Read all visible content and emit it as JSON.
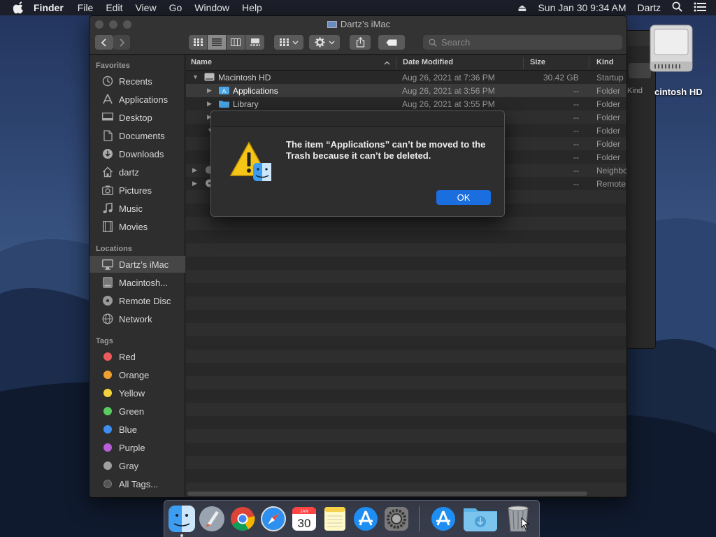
{
  "menubar": {
    "app_name": "Finder",
    "items": [
      "File",
      "Edit",
      "View",
      "Go",
      "Window",
      "Help"
    ],
    "clock": "Sun Jan 30  9:34 AM",
    "user": "Dartz"
  },
  "window": {
    "title": "Dartz’s iMac",
    "search_placeholder": "Search"
  },
  "sidebar": {
    "favorites_header": "Favorites",
    "favorites": [
      "Recents",
      "Applications",
      "Desktop",
      "Documents",
      "Downloads",
      "dartz",
      "Pictures",
      "Music",
      "Movies"
    ],
    "locations_header": "Locations",
    "locations": [
      "Dartz’s iMac",
      "Macintosh...",
      "Remote Disc",
      "Network"
    ],
    "tags_header": "Tags",
    "tags": [
      {
        "label": "Red",
        "color": "#ec5b5b"
      },
      {
        "label": "Orange",
        "color": "#f0a030"
      },
      {
        "label": "Yellow",
        "color": "#f3d33c"
      },
      {
        "label": "Green",
        "color": "#5ccb5f"
      },
      {
        "label": "Blue",
        "color": "#3d8ef0"
      },
      {
        "label": "Purple",
        "color": "#b85fd8"
      },
      {
        "label": "Gray",
        "color": "#a0a0a0"
      }
    ],
    "all_tags": "All Tags..."
  },
  "columns": {
    "name": "Name",
    "date": "Date Modified",
    "size": "Size",
    "kind": "Kind"
  },
  "rows": [
    {
      "name": "Macintosh HD",
      "date": "Aug 26, 2021 at 7:36 PM",
      "size": "30.42 GB",
      "kind": "Startup"
    },
    {
      "name": "Applications",
      "date": "Aug 26, 2021 at 3:56 PM",
      "size": "--",
      "kind": "Folder"
    },
    {
      "name": "Library",
      "date": "Aug 26, 2021 at 3:55 PM",
      "size": "--",
      "kind": "Folder"
    },
    {
      "name": "",
      "date": "",
      "size": "--",
      "kind": "Folder"
    },
    {
      "name": "",
      "date": "",
      "size": "--",
      "kind": "Folder"
    },
    {
      "name": "",
      "date": "",
      "size": "--",
      "kind": "Folder"
    },
    {
      "name": "",
      "date": "",
      "size": "--",
      "kind": "Folder"
    },
    {
      "name": "",
      "date": "",
      "size": "--",
      "kind": "Neighbo"
    },
    {
      "name": "",
      "date": "",
      "size": "--",
      "kind": "Remote"
    }
  ],
  "alert": {
    "message": "The item “Applications” can’t be moved to the Trash because it can’t be deleted.",
    "ok_label": "OK"
  },
  "desktop": {
    "hd_label": "cintosh HD",
    "back_window_kind": "Kind"
  },
  "dock": {
    "calendar_month": "JAN",
    "calendar_day": "30"
  }
}
